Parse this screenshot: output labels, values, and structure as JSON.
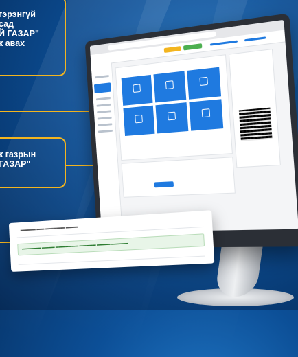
{
  "callouts": {
    "top": [
      "гэрэнгүй",
      "сад",
      "Й ГАЗАР\"",
      "к авах"
    ],
    "middle": [
      "к газрын",
      "ГАЗАР\""
    ]
  },
  "colors": {
    "background": "#0c4f97",
    "accent": "#f3b51f",
    "tile": "#1f7ae0",
    "success_bg": "#e8f5e8",
    "success_text": "#2e7d32"
  }
}
